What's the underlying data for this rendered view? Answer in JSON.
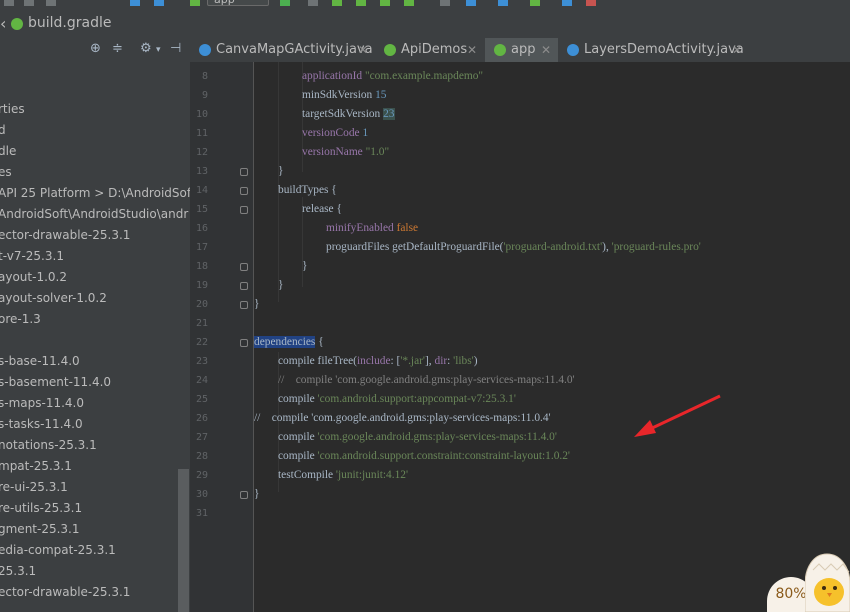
{
  "toolbar": {
    "run_config": "app"
  },
  "breadcrumb": {
    "file": "build.gradle"
  },
  "project_tree": {
    "items": [
      "rties",
      "d",
      "dle",
      "es",
      "API 25 Platform >  D:\\AndroidSof",
      "AndroidSoft\\AndroidStudio\\andr",
      "ector-drawable-25.3.1",
      "t-v7-25.3.1",
      "ayout-1.0.2",
      "ayout-solver-1.0.2",
      "ore-1.3",
      "s-base-11.4.0",
      "s-basement-11.4.0",
      "s-maps-11.4.0",
      "s-tasks-11.4.0",
      "notations-25.3.1",
      "mpat-25.3.1",
      "re-ui-25.3.1",
      "re-utils-25.3.1",
      "gment-25.3.1",
      "edia-compat-25.3.1",
      "25.3.1",
      "ector-drawable-25.3.1"
    ]
  },
  "tabs": [
    {
      "label": "CanvaMapGActivity.java",
      "icon": "class-icon",
      "color": "#3d8fd6"
    },
    {
      "label": "ApiDemos",
      "icon": "gradle-icon",
      "color": "#62b543"
    },
    {
      "label": "app",
      "icon": "gradle-icon",
      "color": "#62b543"
    },
    {
      "label": "LayersDemoActivity.java",
      "icon": "class-icon",
      "color": "#3d8fd6"
    }
  ],
  "active_tab": "app",
  "editor": {
    "line_numbers": [
      "8",
      "9",
      "10",
      "11",
      "12",
      "13",
      "14",
      "15",
      "16",
      "17",
      "18",
      "19",
      "20",
      "21",
      "22",
      "23",
      "24",
      "25",
      "26",
      "27",
      "28",
      "29",
      "30",
      "31"
    ],
    "lines": {
      "l8_key": "applicationId",
      "l8_val": "\"com.example.mapdemo\"",
      "l9_key": "minSdkVersion",
      "l9_val": "15",
      "l10_key": "targetSdkVersion",
      "l10_val": "23",
      "l11_key": "versionCode",
      "l11_val": "1",
      "l12_key": "versionName",
      "l12_val": "\"1.0\"",
      "l13": "}",
      "l14": "buildTypes {",
      "l15": "release {",
      "l16_key": "minifyEnabled",
      "l16_val": "false",
      "l17_a": "proguardFiles getDefaultProguardFile(",
      "l17_b": "'proguard-android.txt'",
      "l17_c": "), ",
      "l17_d": "'proguard-rules.pro'",
      "l18": "}",
      "l19": "}",
      "l20": "}",
      "l22_hl": "dependencies",
      "l22_rest": " {",
      "l23_a": "compile fileTree(",
      "l23_b": "include",
      "l23_c": ": [",
      "l23_d": "'*.jar'",
      "l23_e": "], ",
      "l23_f": "dir",
      "l23_g": ": ",
      "l23_h": "'libs'",
      "l23_i": ")",
      "l24": "//    compile 'com.google.android.gms:play-services-maps:11.4.0'",
      "l25_a": "compile ",
      "l25_b": "'com.android.support:appcompat-v7:25.3.1'",
      "l26": "//    compile 'com.google.android.gms:play-services-maps:11.0.4'",
      "l27_a": "compile ",
      "l27_b": "'com.google.android.gms:play-services-maps:11.4.0'",
      "l28_a": "compile ",
      "l28_b": "'com.android.support.constraint:constraint-layout:1.0.2'",
      "l29_a": "testCompile ",
      "l29_b": "'junit:junit:4.12'",
      "l30": "}"
    }
  },
  "annotation": {
    "color": "#e8262a"
  },
  "badge": {
    "zoom": "80%"
  }
}
